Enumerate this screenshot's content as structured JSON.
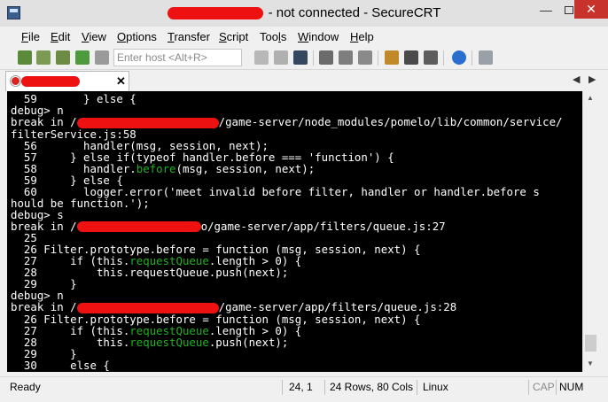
{
  "window": {
    "title_suffix": "- not connected - SecureCRT"
  },
  "menu": [
    "File",
    "Edit",
    "View",
    "Options",
    "Transfer",
    "Script",
    "Tools",
    "Window",
    "Help"
  ],
  "menu_mnemonics": [
    "F",
    "E",
    "V",
    "O",
    "T",
    "S",
    "l",
    "W",
    "H"
  ],
  "toolbar": {
    "host_placeholder": "Enter host <Alt+R>"
  },
  "terminal": {
    "lines": [
      "  59       } else {",
      "debug> n",
      "break in /",
      "filterService.js:58",
      "  56       handler(msg, session, next);",
      "  57     } else if(typeof handler.before === 'function') {",
      "  58       handler.before(msg, session, next);",
      "  59     } else {",
      "  60       logger.error('meet invalid before filter, handler or handler.before s",
      "hould be function.');",
      "debug> s",
      "break in /",
      "  25",
      "  26 Filter.prototype.before = function (msg, session, next) {",
      "  27     if (this.requestQueue.length > 0) {",
      "  28         this.requestQueue.push(next);",
      "  29     }",
      "debug> n",
      "break in /",
      "  26 Filter.prototype.before = function (msg, session, next) {",
      "  27     if (this.requestQueue.length > 0) {",
      "  28         this.requestQueue.push(next);",
      "  29     }",
      "  30     else {"
    ],
    "break1_path": "/game-server/node_modules/pomelo/lib/common/service/",
    "break2_path": "o/game-server/app/filters/queue.js:27",
    "break3_path": "/game-server/app/filters/queue.js:28"
  },
  "status": {
    "ready": "Ready",
    "cursor": "24,  1",
    "size": "24 Rows, 80 Cols",
    "os": "Linux",
    "cap": "CAP",
    "num": "NUM"
  },
  "colors": {
    "terminal_bg": "#000000",
    "terminal_fg": "#ffffff",
    "highlight_green": "#20b020",
    "redaction": "#ee1111",
    "close_button": "#c7332c"
  }
}
